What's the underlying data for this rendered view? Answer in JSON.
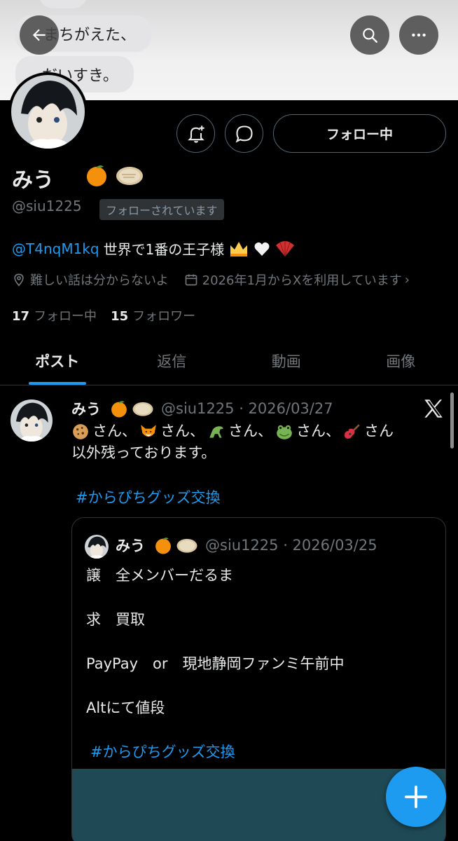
{
  "banner": {
    "bubble_top": "",
    "bubble_1": "まちがえた、",
    "bubble_2": "だいすき。"
  },
  "profile": {
    "display_name": "みう",
    "name_emojis": [
      "orange-emoji",
      "flatbread-emoji"
    ],
    "handle": "@siu1225",
    "follows_you_badge": "フォローされています",
    "follow_button": "フォロー中",
    "bio_mention": "@T4nqM1kq",
    "bio_text": "世界で1番の王子様",
    "bio_emojis": [
      "crown-emoji",
      "white-heart-emoji",
      "fan-emoji"
    ],
    "location": "難しい話は分からないよ",
    "joined": "2026年1月からXを利用しています",
    "following_count": "17",
    "following_label": "フォロー中",
    "followers_count": "15",
    "followers_label": "フォロワー"
  },
  "tabs": [
    {
      "label": "ポスト",
      "active": true
    },
    {
      "label": "返信",
      "active": false
    },
    {
      "label": "動画",
      "active": false
    },
    {
      "label": "画像",
      "active": false
    }
  ],
  "post": {
    "name": "みう",
    "meta": "@siu1225 · 2026/03/27",
    "san_1": "さん、",
    "san_2": "さん、",
    "san_3": "さん、",
    "san_4": "さん、",
    "san_5": "さん",
    "line_2": "以外残っております。",
    "hashtag": "#からぴちグッズ交換",
    "emojis": [
      "cookie-emoji",
      "fox-emoji",
      "dinosaur-emoji",
      "frog-emoji",
      "guitar-emoji"
    ]
  },
  "quote": {
    "name": "みう",
    "meta": "@siu1225 · 2026/03/25",
    "line_1": "譲　全メンバーだるま",
    "line_2": "求　買取",
    "line_3": "PayPay　or　現地静岡ファンミ午前中",
    "line_4": "Altにて値段",
    "hashtag": "#からぴちグッズ交換"
  },
  "colors": {
    "accent": "#1d9bf0",
    "background": "#000000",
    "muted": "#71767b",
    "border": "#2f3336"
  }
}
